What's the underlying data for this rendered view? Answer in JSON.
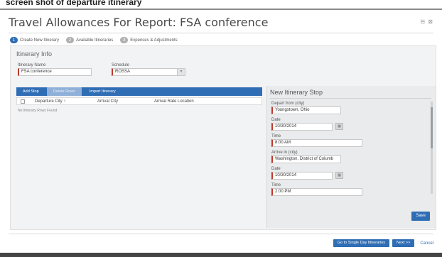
{
  "page_caption": "screen shot of departure itinerary",
  "dialog": {
    "title": "Travel Allowances For Report: FSA conference",
    "window_controls": "⊟ ⊠"
  },
  "steps": [
    {
      "num": "1",
      "label": "Create New Itinerary",
      "active": true
    },
    {
      "num": "2",
      "label": "Available Itineraries",
      "active": false
    },
    {
      "num": "3",
      "label": "Expenses & Adjustments",
      "active": false
    }
  ],
  "itinerary_info": {
    "section_title": "Itinerary Info",
    "name_label": "Itinerary Name",
    "name_value": "FSA conference",
    "schedule_label": "Schedule",
    "schedule_value": "ROSSA"
  },
  "toolbar": {
    "add_stop": "Add Stop",
    "delete_rows": "Delete Rows",
    "import_itinerary": "Import Itinerary"
  },
  "table": {
    "columns": [
      "Departure City ↑",
      "Arrival City",
      "Arrival Rate Location"
    ],
    "empty_message": "No Itinerary Rows Found"
  },
  "new_stop": {
    "title": "New Itinerary Stop",
    "depart_from_label": "Depart from (city)",
    "depart_from_value": "Youngstown, Ohio",
    "date1_label": "Date",
    "date1_value": "10/30/2014",
    "time1_label": "Time",
    "time1_value": "8:00 AM",
    "arrive_in_label": "Arrive in (city)",
    "arrive_in_value": "Washington, District of Columb",
    "date2_label": "Date",
    "date2_value": "10/30/2014",
    "time2_label": "Time",
    "time2_value": "2:00 PM",
    "save_label": "Save"
  },
  "footer": {
    "single_day_label": "Go to Single Day Itineraries",
    "next_label": "Next >>",
    "cancel_label": "Cancel"
  },
  "colors": {
    "accent": "#2f6db5",
    "required_marker": "#c0392b"
  }
}
